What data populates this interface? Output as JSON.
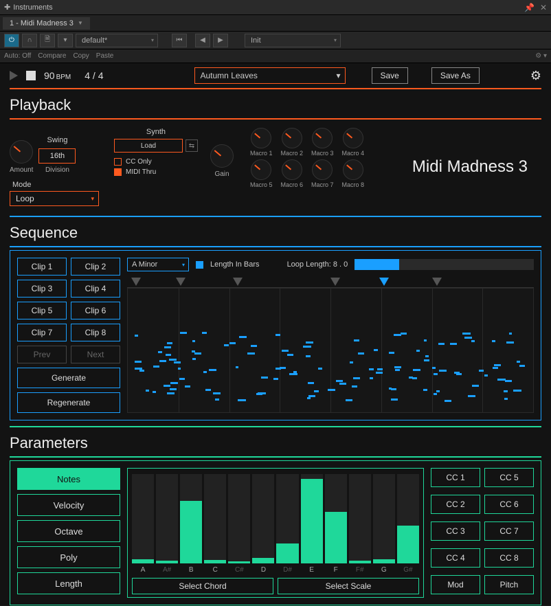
{
  "window": {
    "title": "Instruments",
    "tab": "1 - Midi Madness 3"
  },
  "host_toolbar": {
    "preset": "default*",
    "preset2": "Init",
    "auto": "Auto: Off",
    "compare": "Compare",
    "copy": "Copy",
    "paste": "Paste"
  },
  "top": {
    "bpm_value": "90",
    "bpm_label": "BPM",
    "timesig": "4 / 4",
    "preset": "Autumn Leaves",
    "save": "Save",
    "saveas": "Save As"
  },
  "playback": {
    "header": "Playback",
    "swing_header": "Swing",
    "amount_label": "Amount",
    "division_value": "16th",
    "division_label": "Division",
    "mode_label": "Mode",
    "mode_value": "Loop",
    "synth_header": "Synth",
    "load_label": "Load",
    "cconly_label": "CC Only",
    "midithru_label": "MIDI Thru",
    "gain_label": "Gain",
    "macros": [
      "Macro 1",
      "Macro 2",
      "Macro 3",
      "Macro 4",
      "Macro 5",
      "Macro 6",
      "Macro 7",
      "Macro 8"
    ],
    "brand": "Midi Madness 3"
  },
  "sequence": {
    "header": "Sequence",
    "clips": [
      "Clip 1",
      "Clip 2",
      "Clip 3",
      "Clip 4",
      "Clip 5",
      "Clip 6",
      "Clip 7",
      "Clip 8"
    ],
    "prev": "Prev",
    "next": "Next",
    "generate": "Generate",
    "regenerate": "Regenerate",
    "scale": "A Minor",
    "length_in_bars": "Length In Bars",
    "loop_length_label": "Loop Length:",
    "loop_length_value": "8 . 0"
  },
  "parameters": {
    "header": "Parameters",
    "tabs": [
      "Notes",
      "Velocity",
      "Octave",
      "Poly",
      "Length"
    ],
    "active_tab": "Notes",
    "bars": [
      {
        "label": "A",
        "h": 5,
        "on": true
      },
      {
        "label": "A#",
        "h": 3,
        "on": false
      },
      {
        "label": "B",
        "h": 70,
        "on": true
      },
      {
        "label": "C",
        "h": 4,
        "on": true
      },
      {
        "label": "C#",
        "h": 2,
        "on": false
      },
      {
        "label": "D",
        "h": 6,
        "on": true
      },
      {
        "label": "D#",
        "h": 22,
        "on": false
      },
      {
        "label": "E",
        "h": 95,
        "on": true
      },
      {
        "label": "F",
        "h": 58,
        "on": true
      },
      {
        "label": "F#",
        "h": 3,
        "on": false
      },
      {
        "label": "G",
        "h": 5,
        "on": true
      },
      {
        "label": "G#",
        "h": 42,
        "on": false
      }
    ],
    "select_chord": "Select Chord",
    "select_scale": "Select Scale",
    "cc": [
      "CC 1",
      "CC 5",
      "CC 2",
      "CC 6",
      "CC 3",
      "CC 7",
      "CC 4",
      "CC 8",
      "Mod",
      "Pitch"
    ]
  },
  "chart_data": {
    "type": "bar",
    "title": "Note probability weights",
    "categories": [
      "A",
      "A#",
      "B",
      "C",
      "C#",
      "D",
      "D#",
      "E",
      "F",
      "F#",
      "G",
      "G#"
    ],
    "values": [
      5,
      3,
      70,
      4,
      2,
      6,
      22,
      95,
      58,
      3,
      5,
      42
    ],
    "ylim": [
      0,
      100
    ]
  }
}
